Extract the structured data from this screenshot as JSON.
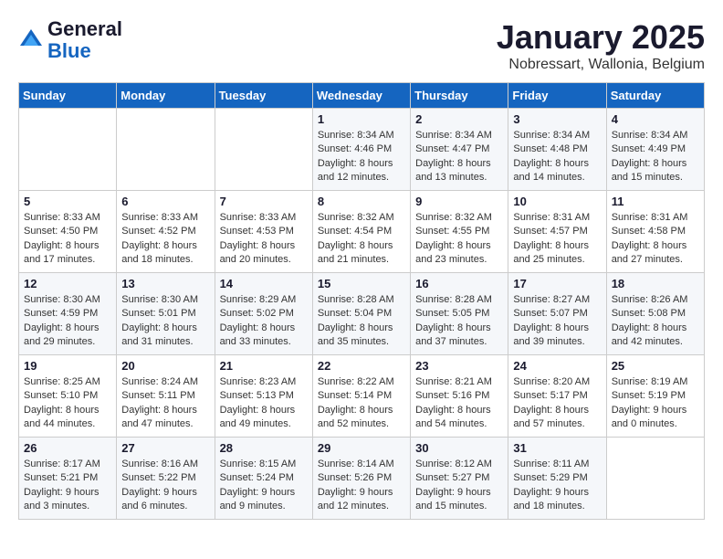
{
  "header": {
    "logo_general": "General",
    "logo_blue": "Blue",
    "month_title": "January 2025",
    "location": "Nobressart, Wallonia, Belgium"
  },
  "weekdays": [
    "Sunday",
    "Monday",
    "Tuesday",
    "Wednesday",
    "Thursday",
    "Friday",
    "Saturday"
  ],
  "weeks": [
    [
      {
        "day": "",
        "info": ""
      },
      {
        "day": "",
        "info": ""
      },
      {
        "day": "",
        "info": ""
      },
      {
        "day": "1",
        "info": "Sunrise: 8:34 AM\nSunset: 4:46 PM\nDaylight: 8 hours\nand 12 minutes."
      },
      {
        "day": "2",
        "info": "Sunrise: 8:34 AM\nSunset: 4:47 PM\nDaylight: 8 hours\nand 13 minutes."
      },
      {
        "day": "3",
        "info": "Sunrise: 8:34 AM\nSunset: 4:48 PM\nDaylight: 8 hours\nand 14 minutes."
      },
      {
        "day": "4",
        "info": "Sunrise: 8:34 AM\nSunset: 4:49 PM\nDaylight: 8 hours\nand 15 minutes."
      }
    ],
    [
      {
        "day": "5",
        "info": "Sunrise: 8:33 AM\nSunset: 4:50 PM\nDaylight: 8 hours\nand 17 minutes."
      },
      {
        "day": "6",
        "info": "Sunrise: 8:33 AM\nSunset: 4:52 PM\nDaylight: 8 hours\nand 18 minutes."
      },
      {
        "day": "7",
        "info": "Sunrise: 8:33 AM\nSunset: 4:53 PM\nDaylight: 8 hours\nand 20 minutes."
      },
      {
        "day": "8",
        "info": "Sunrise: 8:32 AM\nSunset: 4:54 PM\nDaylight: 8 hours\nand 21 minutes."
      },
      {
        "day": "9",
        "info": "Sunrise: 8:32 AM\nSunset: 4:55 PM\nDaylight: 8 hours\nand 23 minutes."
      },
      {
        "day": "10",
        "info": "Sunrise: 8:31 AM\nSunset: 4:57 PM\nDaylight: 8 hours\nand 25 minutes."
      },
      {
        "day": "11",
        "info": "Sunrise: 8:31 AM\nSunset: 4:58 PM\nDaylight: 8 hours\nand 27 minutes."
      }
    ],
    [
      {
        "day": "12",
        "info": "Sunrise: 8:30 AM\nSunset: 4:59 PM\nDaylight: 8 hours\nand 29 minutes."
      },
      {
        "day": "13",
        "info": "Sunrise: 8:30 AM\nSunset: 5:01 PM\nDaylight: 8 hours\nand 31 minutes."
      },
      {
        "day": "14",
        "info": "Sunrise: 8:29 AM\nSunset: 5:02 PM\nDaylight: 8 hours\nand 33 minutes."
      },
      {
        "day": "15",
        "info": "Sunrise: 8:28 AM\nSunset: 5:04 PM\nDaylight: 8 hours\nand 35 minutes."
      },
      {
        "day": "16",
        "info": "Sunrise: 8:28 AM\nSunset: 5:05 PM\nDaylight: 8 hours\nand 37 minutes."
      },
      {
        "day": "17",
        "info": "Sunrise: 8:27 AM\nSunset: 5:07 PM\nDaylight: 8 hours\nand 39 minutes."
      },
      {
        "day": "18",
        "info": "Sunrise: 8:26 AM\nSunset: 5:08 PM\nDaylight: 8 hours\nand 42 minutes."
      }
    ],
    [
      {
        "day": "19",
        "info": "Sunrise: 8:25 AM\nSunset: 5:10 PM\nDaylight: 8 hours\nand 44 minutes."
      },
      {
        "day": "20",
        "info": "Sunrise: 8:24 AM\nSunset: 5:11 PM\nDaylight: 8 hours\nand 47 minutes."
      },
      {
        "day": "21",
        "info": "Sunrise: 8:23 AM\nSunset: 5:13 PM\nDaylight: 8 hours\nand 49 minutes."
      },
      {
        "day": "22",
        "info": "Sunrise: 8:22 AM\nSunset: 5:14 PM\nDaylight: 8 hours\nand 52 minutes."
      },
      {
        "day": "23",
        "info": "Sunrise: 8:21 AM\nSunset: 5:16 PM\nDaylight: 8 hours\nand 54 minutes."
      },
      {
        "day": "24",
        "info": "Sunrise: 8:20 AM\nSunset: 5:17 PM\nDaylight: 8 hours\nand 57 minutes."
      },
      {
        "day": "25",
        "info": "Sunrise: 8:19 AM\nSunset: 5:19 PM\nDaylight: 9 hours\nand 0 minutes."
      }
    ],
    [
      {
        "day": "26",
        "info": "Sunrise: 8:17 AM\nSunset: 5:21 PM\nDaylight: 9 hours\nand 3 minutes."
      },
      {
        "day": "27",
        "info": "Sunrise: 8:16 AM\nSunset: 5:22 PM\nDaylight: 9 hours\nand 6 minutes."
      },
      {
        "day": "28",
        "info": "Sunrise: 8:15 AM\nSunset: 5:24 PM\nDaylight: 9 hours\nand 9 minutes."
      },
      {
        "day": "29",
        "info": "Sunrise: 8:14 AM\nSunset: 5:26 PM\nDaylight: 9 hours\nand 12 minutes."
      },
      {
        "day": "30",
        "info": "Sunrise: 8:12 AM\nSunset: 5:27 PM\nDaylight: 9 hours\nand 15 minutes."
      },
      {
        "day": "31",
        "info": "Sunrise: 8:11 AM\nSunset: 5:29 PM\nDaylight: 9 hours\nand 18 minutes."
      },
      {
        "day": "",
        "info": ""
      }
    ]
  ]
}
